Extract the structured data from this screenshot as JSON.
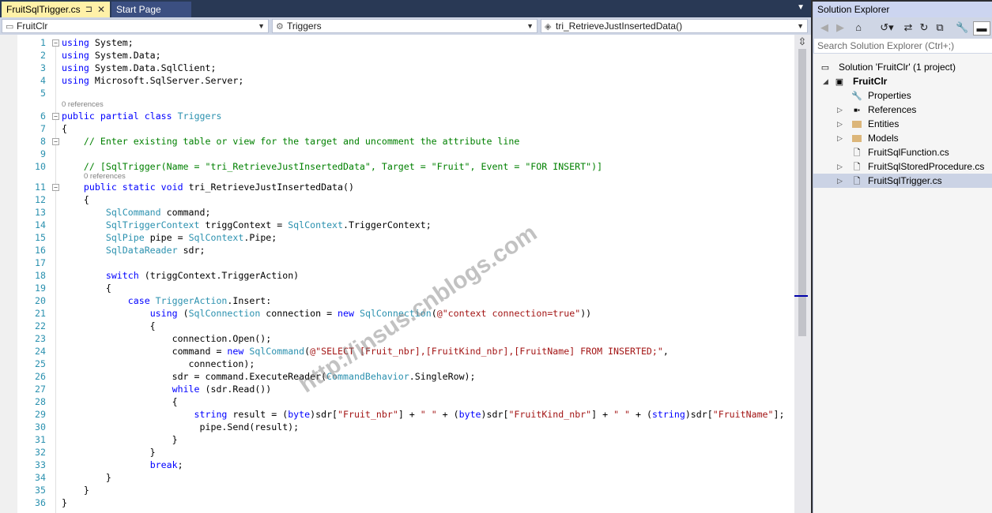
{
  "tabs": {
    "active": {
      "label": "FruitSqlTrigger.cs",
      "pin": "⊐",
      "close": "✕"
    },
    "start": {
      "label": "Start Page"
    },
    "overflow": "▼"
  },
  "navbar": {
    "project": "FruitClr",
    "class": "Triggers",
    "member": "tri_RetrieveJustInsertedData()"
  },
  "editor": {
    "refs_a": "0 references",
    "refs_b": "0 references",
    "lines": [
      {
        "n": "1"
      },
      {
        "n": "2"
      },
      {
        "n": "3"
      },
      {
        "n": "4"
      },
      {
        "n": "5"
      },
      {
        "n": "6"
      },
      {
        "n": "7"
      },
      {
        "n": "8"
      },
      {
        "n": "9"
      },
      {
        "n": "10"
      },
      {
        "n": "11"
      },
      {
        "n": "12"
      },
      {
        "n": "13"
      },
      {
        "n": "14"
      },
      {
        "n": "15"
      },
      {
        "n": "16"
      },
      {
        "n": "17"
      },
      {
        "n": "18"
      },
      {
        "n": "19"
      },
      {
        "n": "20"
      },
      {
        "n": "21"
      },
      {
        "n": "22"
      },
      {
        "n": "23"
      },
      {
        "n": "24"
      },
      {
        "n": "25"
      },
      {
        "n": "26"
      },
      {
        "n": "27"
      },
      {
        "n": "28"
      },
      {
        "n": "29"
      },
      {
        "n": "30"
      },
      {
        "n": "31"
      },
      {
        "n": "32"
      },
      {
        "n": "33"
      },
      {
        "n": "34"
      },
      {
        "n": "35"
      },
      {
        "n": "36"
      }
    ],
    "code": {
      "l1": [
        "using",
        " System;"
      ],
      "l2": [
        "using",
        " System.Data;"
      ],
      "l3": [
        "using",
        " System.Data.SqlClient;"
      ],
      "l4": [
        "using",
        " Microsoft.SqlServer.Server;"
      ],
      "l6": [
        "public",
        " ",
        "partial",
        " ",
        "class",
        " ",
        "Triggers"
      ],
      "l7": "{",
      "l8": "    // Enter existing table or view for the target and uncomment the attribute line",
      "l10": "    // [SqlTrigger(Name = \"tri_RetrieveJustInsertedData\", Target = \"Fruit\", Event = \"FOR INSERT\")]",
      "l11": [
        "    ",
        "public",
        " ",
        "static",
        " ",
        "void",
        " tri_RetrieveJustInsertedData()"
      ],
      "l12": "    {",
      "l13": [
        "        ",
        "SqlCommand",
        " command;"
      ],
      "l14": [
        "        ",
        "SqlTriggerContext",
        " triggContext = ",
        "SqlContext",
        ".TriggerContext;"
      ],
      "l15": [
        "        ",
        "SqlPipe",
        " pipe = ",
        "SqlContext",
        ".Pipe;"
      ],
      "l16": [
        "        ",
        "SqlDataReader",
        " sdr;"
      ],
      "l18": [
        "        ",
        "switch",
        " (triggContext.TriggerAction)"
      ],
      "l19": "        {",
      "l20": [
        "            ",
        "case",
        " ",
        "TriggerAction",
        ".Insert:"
      ],
      "l21": [
        "                ",
        "using",
        " (",
        "SqlConnection",
        " connection = ",
        "new",
        " ",
        "SqlConnection",
        "(",
        "@\"context connection=true\"",
        "))"
      ],
      "l22": "                {",
      "l23": "                    connection.Open();",
      "l24": [
        "                    command = ",
        "new",
        " ",
        "SqlCommand",
        "(",
        "@\"SELECT [Fruit_nbr],[FruitKind_nbr],[FruitName] FROM INSERTED;\"",
        ","
      ],
      "l25": "                       connection);",
      "l26": [
        "                    sdr = command.ExecuteReader(",
        "CommandBehavior",
        ".SingleRow);"
      ],
      "l27": [
        "                    ",
        "while",
        " (sdr.Read())"
      ],
      "l28": "                    {",
      "l29": [
        "                        ",
        "string",
        " result = (",
        "byte",
        ")sdr[",
        "\"Fruit_nbr\"",
        "] + ",
        "\" \"",
        " + (",
        "byte",
        ")sdr[",
        "\"FruitKind_nbr\"",
        "] + ",
        "\" \"",
        " + (",
        "string",
        ")sdr[",
        "\"FruitName\"",
        "];"
      ],
      "l30": "                         pipe.Send(result);",
      "l31": "                    }",
      "l32": "                }",
      "l33": [
        "                ",
        "break",
        ";"
      ],
      "l34": "        }",
      "l35": "    }",
      "l36": "}"
    },
    "watermark": "http://insus.cnblogs.com"
  },
  "solution_explorer": {
    "title": "Solution Explorer",
    "search_placeholder": "Search Solution Explorer (Ctrl+;)",
    "solution": "Solution 'FruitClr' (1 project)",
    "project": "FruitClr",
    "items": [
      {
        "label": "Properties",
        "expandable": false,
        "icon": "wrench-icon"
      },
      {
        "label": "References",
        "expandable": true,
        "icon": "references-icon"
      },
      {
        "label": "Entities",
        "expandable": true,
        "icon": "folder-icon"
      },
      {
        "label": "Models",
        "expandable": true,
        "icon": "folder-icon"
      },
      {
        "label": "FruitSqlFunction.cs",
        "expandable": false,
        "icon": "cs-file-icon"
      },
      {
        "label": "FruitSqlStoredProcedure.cs",
        "expandable": true,
        "icon": "cs-file-icon"
      },
      {
        "label": "FruitSqlTrigger.cs",
        "expandable": true,
        "icon": "cs-file-icon",
        "selected": true
      }
    ]
  },
  "colors": {
    "keyword": "#0000ff",
    "type": "#2b91af",
    "string": "#a31515",
    "comment": "#008000",
    "active_tab": "#fff1a8",
    "chrome": "#293955"
  }
}
